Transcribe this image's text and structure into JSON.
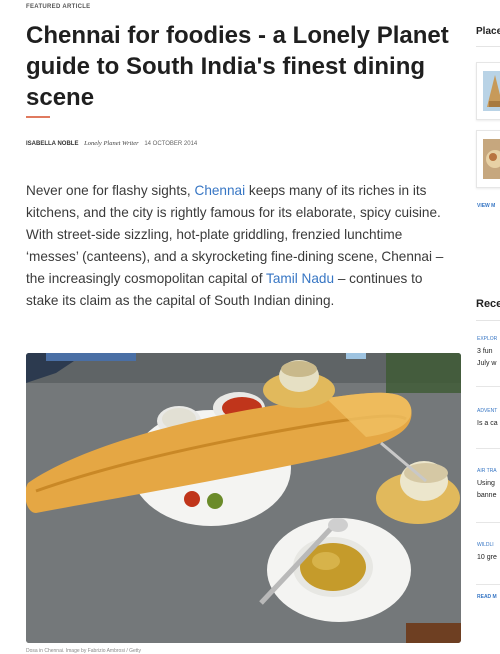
{
  "article": {
    "eyebrow": "FEATURED ARTICLE",
    "title": "Chennai for foodies - a Lonely Planet guide to South India's finest dining scene",
    "author": "ISABELLA NOBLE",
    "author_role": "Lonely Planet Writer",
    "date": "14 OCTOBER 2014",
    "intro_parts": {
      "p1": "Never one for flashy sights, ",
      "link1": "Chennai",
      "p2": " keeps many of its riches in its kitchens, and the city is rightly famous for its elaborate, spicy cuisine. With street-side sizzling, hot-plate griddling, frenzied lunchtime ‘messes’ (canteens), and a skyrocketing fine-dining scene, Chennai – the increasingly cosmopolitan capital of ",
      "link2": "Tamil Nadu",
      "p3": " – continues to stake its claim as the capital of South Indian dining."
    },
    "caption": "Dosa in Chennai. Image by Fabrizio Ambrosi / Getty"
  },
  "sidebar": {
    "places_title": "Place",
    "view_more": "VIEW M",
    "recent_title": "Rece",
    "recent_items": [
      {
        "category": "EXPLOR",
        "line1": "3 fun",
        "line2": "July w"
      },
      {
        "category": "ADVENT",
        "line1": "Is a ca",
        "line2": ""
      },
      {
        "category": "AIR TRA",
        "line1": "Using",
        "line2": "banne"
      },
      {
        "category": "WILDLI",
        "line1": "10 gre",
        "line2": ""
      }
    ],
    "read_more": "READ M"
  },
  "colors": {
    "link": "#3776c4",
    "accent_rule": "#e07a5f"
  }
}
